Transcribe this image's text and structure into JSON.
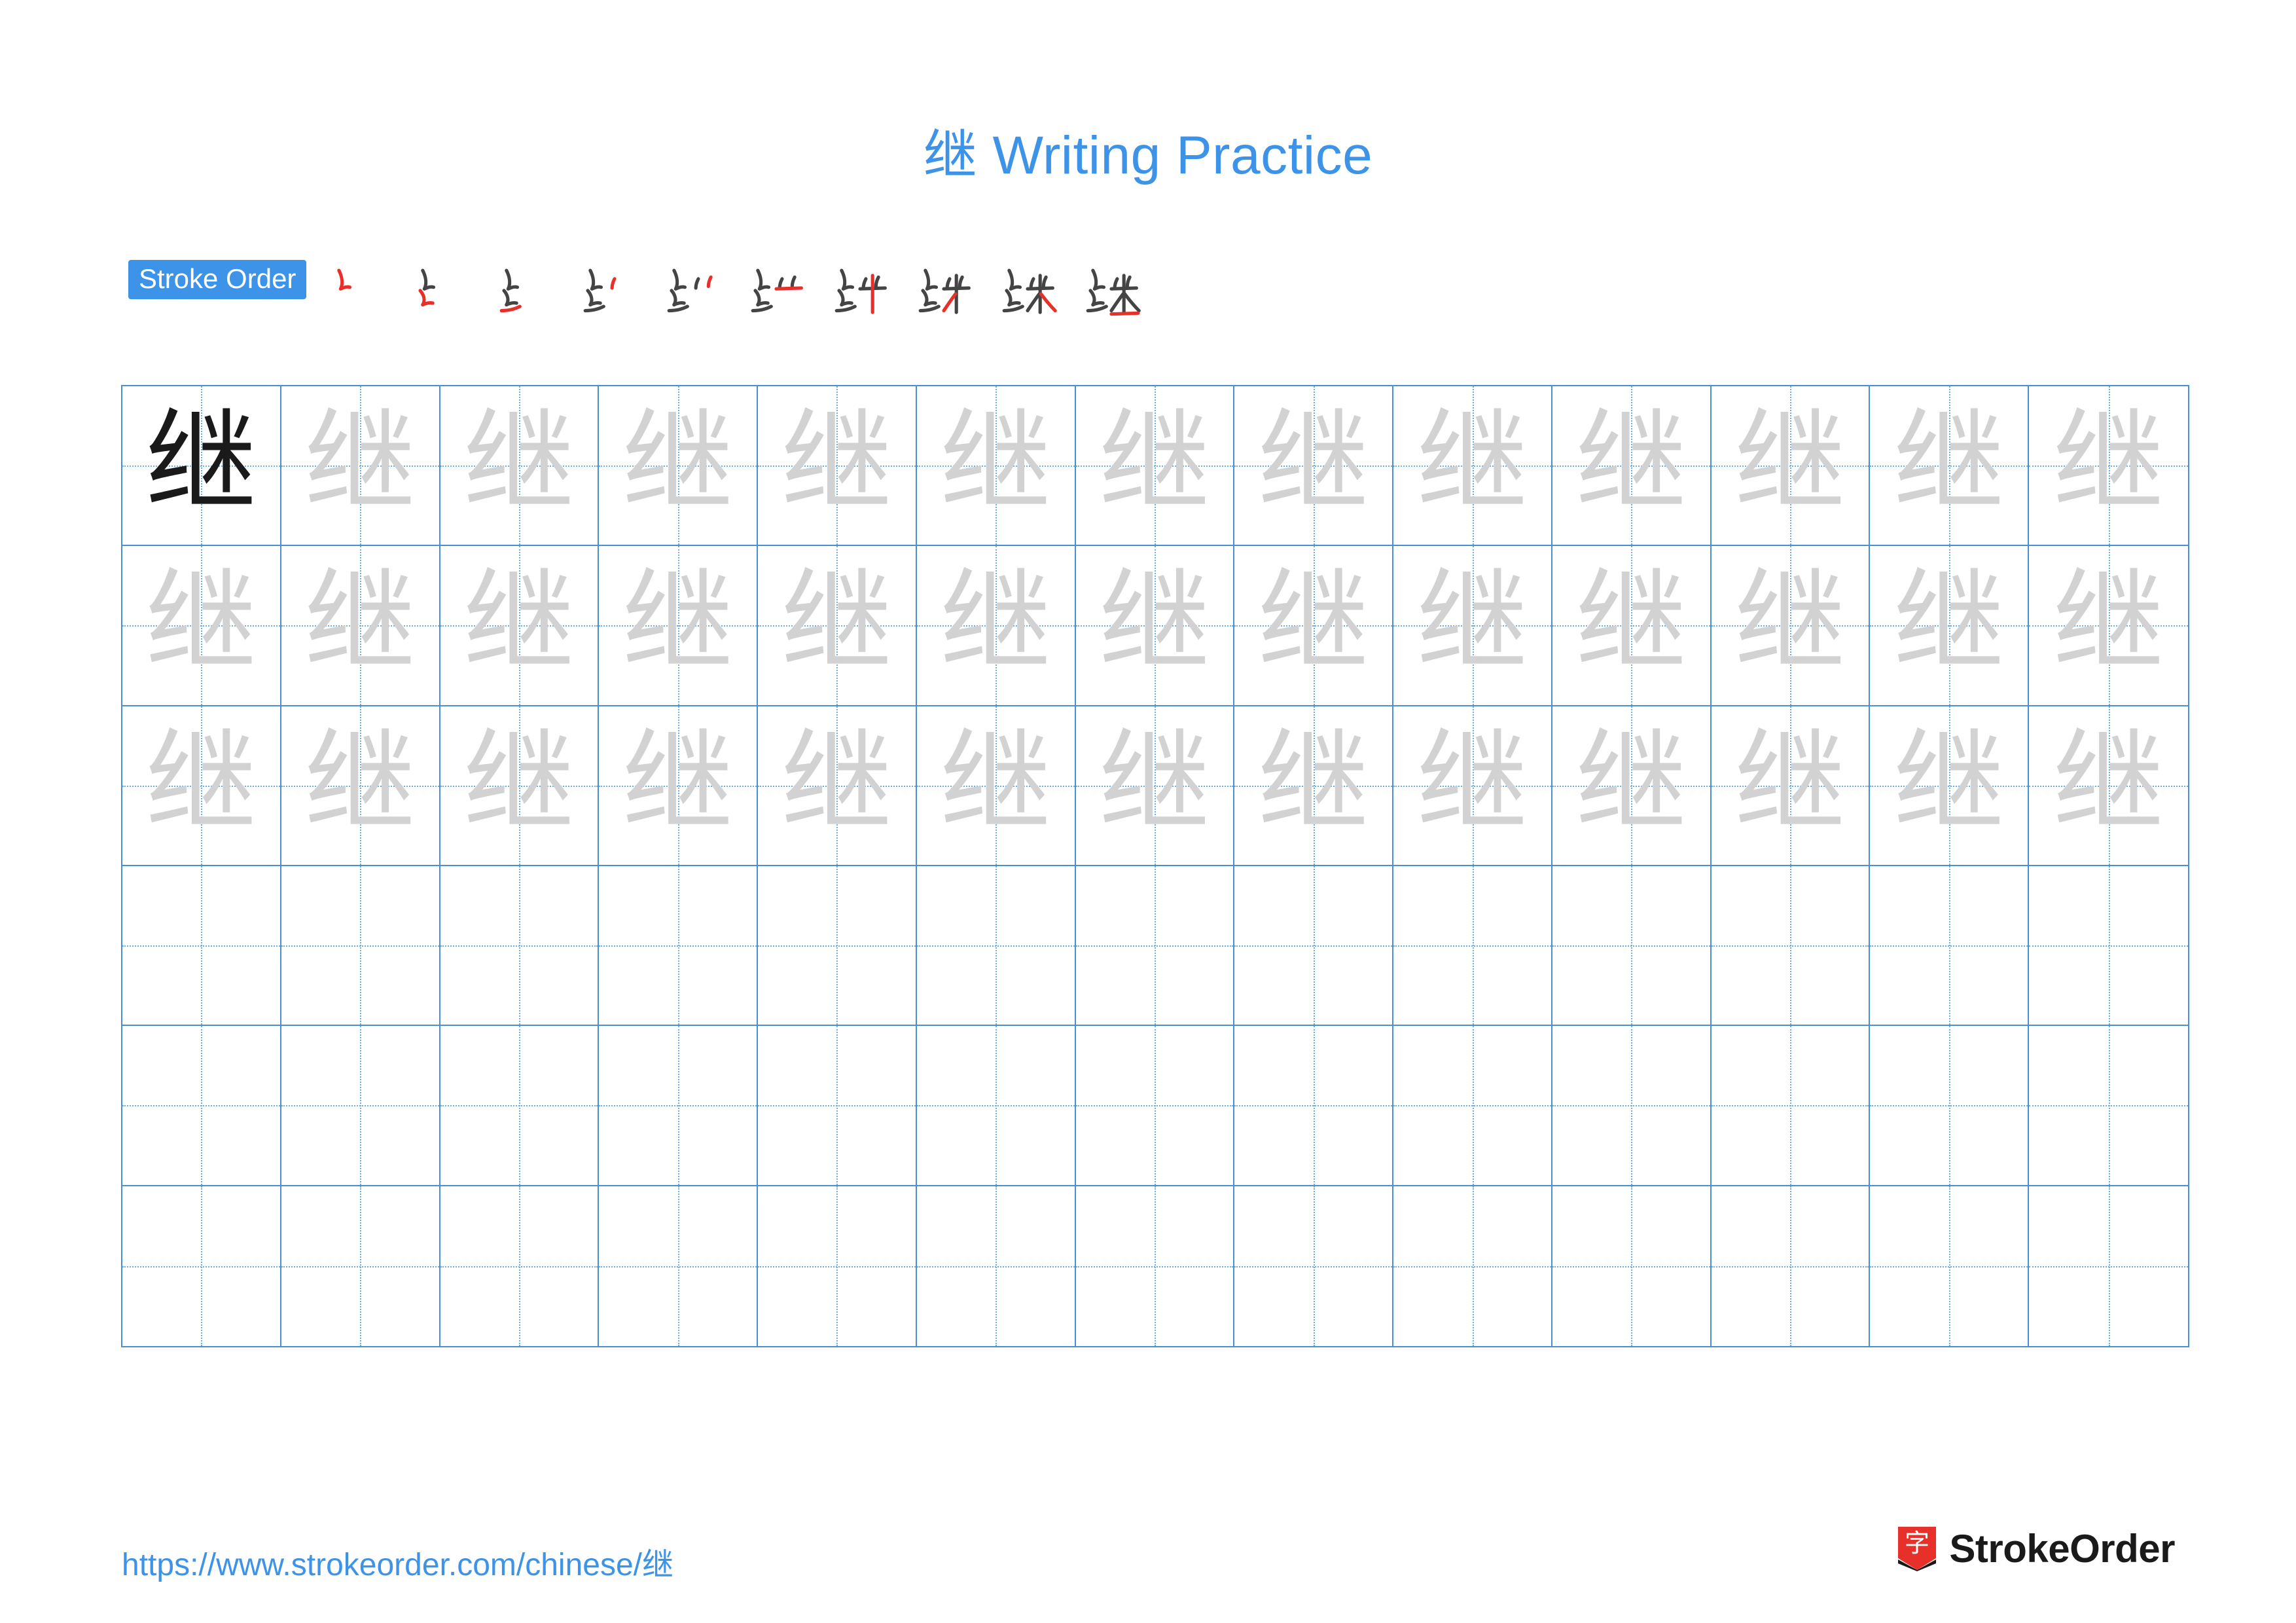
{
  "page": {
    "character": "继",
    "title_suffix": " Writing Practice",
    "title_full": "继 Writing Practice"
  },
  "stroke_order": {
    "label": "Stroke Order",
    "steps_count": 10,
    "steps": [
      {
        "index": 1,
        "new_stroke": "撇折 (pie-zhe) top"
      },
      {
        "index": 2,
        "new_stroke": "撇折 (pie-zhe) second"
      },
      {
        "index": 3,
        "new_stroke": "提 (ti)"
      },
      {
        "index": 4,
        "new_stroke": "竖 right component first dot"
      },
      {
        "index": 5,
        "new_stroke": "点 (dian) upper right"
      },
      {
        "index": 6,
        "new_stroke": "横 (heng) right"
      },
      {
        "index": 7,
        "new_stroke": "竖 (shu) center"
      },
      {
        "index": 8,
        "new_stroke": "撇 (pie) left"
      },
      {
        "index": 9,
        "new_stroke": "捺 (na) right"
      },
      {
        "index": 10,
        "new_stroke": "横 (heng) bottom"
      }
    ]
  },
  "practice_grid": {
    "columns": 13,
    "rows": 6,
    "cells": [
      [
        "dark",
        "light",
        "light",
        "light",
        "light",
        "light",
        "light",
        "light",
        "light",
        "light",
        "light",
        "light",
        "light"
      ],
      [
        "light",
        "light",
        "light",
        "light",
        "light",
        "light",
        "light",
        "light",
        "light",
        "light",
        "light",
        "light",
        "light"
      ],
      [
        "light",
        "light",
        "light",
        "light",
        "light",
        "light",
        "light",
        "light",
        "light",
        "light",
        "light",
        "light",
        "light"
      ],
      [
        "empty",
        "empty",
        "empty",
        "empty",
        "empty",
        "empty",
        "empty",
        "empty",
        "empty",
        "empty",
        "empty",
        "empty",
        "empty"
      ],
      [
        "empty",
        "empty",
        "empty",
        "empty",
        "empty",
        "empty",
        "empty",
        "empty",
        "empty",
        "empty",
        "empty",
        "empty",
        "empty"
      ],
      [
        "empty",
        "empty",
        "empty",
        "empty",
        "empty",
        "empty",
        "empty",
        "empty",
        "empty",
        "empty",
        "empty",
        "empty",
        "empty"
      ]
    ]
  },
  "footer": {
    "url": "https://www.strokeorder.com/chinese/继",
    "brand_name": "StrokeOrder",
    "brand_logo_char": "字"
  },
  "colors": {
    "title": "#3d93e8",
    "label_bg": "#3d93e8",
    "grid_line": "#4a8fd4",
    "grid_dotted": "#6aaee8",
    "new_stroke": "#e8302a",
    "old_stroke": "#444444",
    "ghost_char": "#d2d2d2",
    "dark_char": "#1a1a1a",
    "footer_link": "#3d93e8"
  }
}
